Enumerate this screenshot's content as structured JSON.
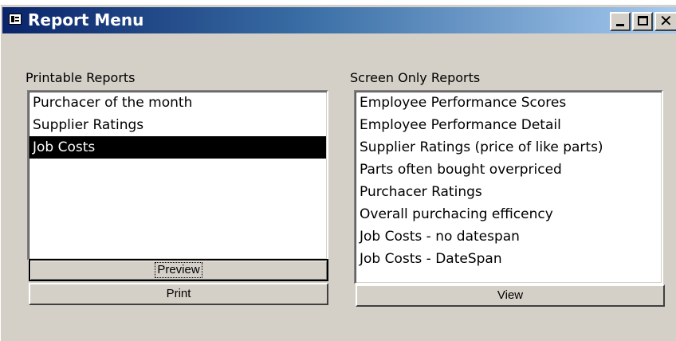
{
  "window": {
    "title": "Report Menu",
    "icon": "form-icon",
    "controls": {
      "minimize": "minimize-icon",
      "maximize": "maximize-icon",
      "close": "close-icon"
    }
  },
  "printable": {
    "label": "Printable Reports",
    "items": [
      {
        "label": "Purchacer of the month"
      },
      {
        "label": "Supplier Ratings"
      },
      {
        "label": "Job Costs"
      }
    ],
    "selected": "Job Costs",
    "preview_label": "Preview",
    "print_label": "Print"
  },
  "screen_only": {
    "label": "Screen Only Reports",
    "items": [
      {
        "label": "Employee Performance Scores"
      },
      {
        "label": "Employee Performance Detail"
      },
      {
        "label": "Supplier Ratings (price of like parts)"
      },
      {
        "label": "Parts often bought overpriced"
      },
      {
        "label": "Purchacer Ratings"
      },
      {
        "label": "Overall purchacing efficency"
      },
      {
        "label": "Job Costs - no datespan"
      },
      {
        "label": "Job Costs - DateSpan"
      }
    ],
    "view_label": "View"
  },
  "colors": {
    "titlebar_start": "#0a246a",
    "titlebar_end": "#a6caf0",
    "face": "#d4d0c8",
    "selection": "#000000"
  }
}
